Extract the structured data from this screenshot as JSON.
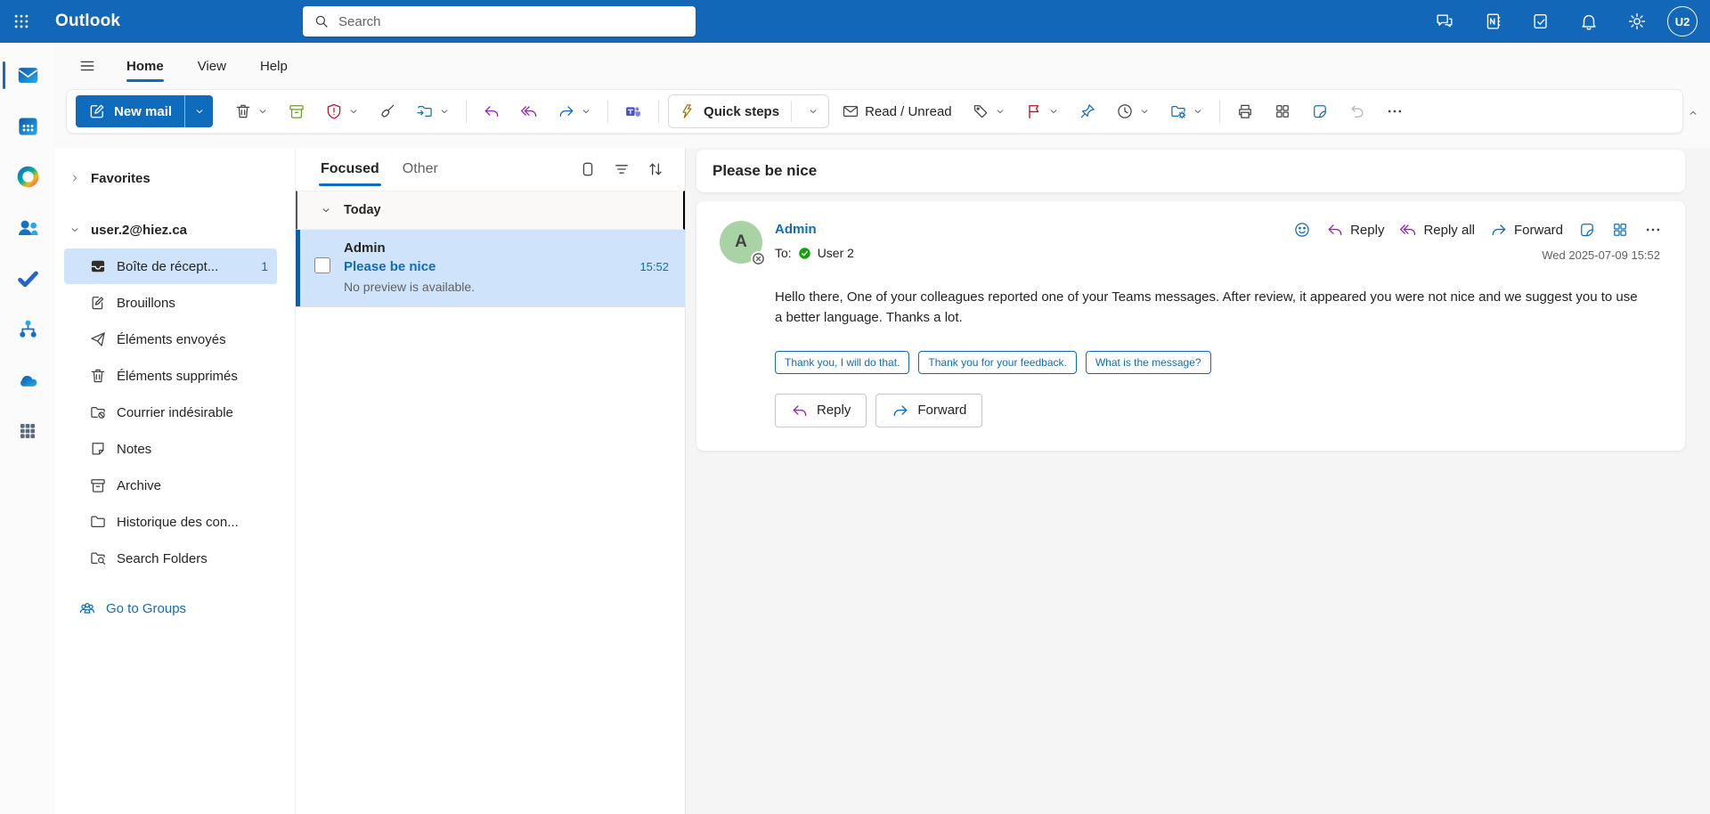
{
  "topbar": {
    "brand": "Outlook",
    "search_placeholder": "Search",
    "avatar": "U2",
    "icons": [
      "app-launcher",
      "search",
      "chat",
      "onenote",
      "todo",
      "notifications",
      "settings",
      "account"
    ]
  },
  "ribbon": {
    "tabs": {
      "home": "Home",
      "view": "View",
      "help": "Help"
    },
    "active_tab": "Home",
    "toolbar": {
      "new_mail": "New mail",
      "quick_steps": "Quick steps",
      "read_unread": "Read / Unread",
      "icons": [
        "compose",
        "delete",
        "archive",
        "report",
        "sweep",
        "move-to",
        "reply",
        "reply-all",
        "forward",
        "share-to-teams",
        "quick-steps-bolt",
        "read-unread-envelope",
        "categorize-tag",
        "flag",
        "pin",
        "snooze-clock",
        "rules",
        "print",
        "apps-grid",
        "sticker",
        "undo",
        "more-options",
        "collapse-ribbon"
      ]
    }
  },
  "app_rail": {
    "items": [
      "mail",
      "calendar",
      "copilot",
      "people",
      "todo",
      "org-explorer",
      "onedrive",
      "more-apps"
    ],
    "selected": "mail"
  },
  "folder_pane": {
    "favorites": "Favorites",
    "account": "user.2@hiez.ca",
    "folders": [
      {
        "label": "Boîte de récept...",
        "count": "1"
      },
      {
        "label": "Brouillons"
      },
      {
        "label": "Éléments envoyés"
      },
      {
        "label": "Éléments supprimés"
      },
      {
        "label": "Courrier indésirable"
      },
      {
        "label": "Notes"
      },
      {
        "label": "Archive"
      },
      {
        "label": "Historique des con..."
      },
      {
        "label": "Search Folders"
      }
    ],
    "go_to_groups": "Go to Groups"
  },
  "message_list": {
    "tab_focused": "Focused",
    "tab_other": "Other",
    "group": "Today",
    "message": {
      "sender": "Admin",
      "subject": "Please be nice",
      "time": "15:52",
      "preview": "No preview is available."
    }
  },
  "reading_pane": {
    "subject": "Please be nice",
    "sender": "Admin",
    "avatar_initial": "A",
    "to_label": "To:",
    "recipient": "User 2",
    "timestamp": "Wed 2025-07-09 15:52",
    "actions": {
      "reply": "Reply",
      "reply_all": "Reply all",
      "forward": "Forward"
    },
    "body": "Hello there, One of your colleagues reported one of your Teams messages. After review, it appeared you were not nice and we suggest you to use a better language. Thanks a lot.",
    "suggested_replies": [
      "Thank you, I will do that.",
      "Thank you for your feedback.",
      "What is the message?"
    ],
    "footer": {
      "reply": "Reply",
      "forward": "Forward"
    }
  },
  "colors": {
    "header_blue": "#1267b8",
    "accent_blue": "#0f6cbd",
    "selection_blue": "#cfe4fa",
    "selection_bar_blue": "#115ea3",
    "reply_purple": "#9027ad",
    "flag_red": "#c50f1f",
    "archive_green": "#6e9f18",
    "avatar_green": "#a9d3a4",
    "presence_green": "#13a10e"
  }
}
